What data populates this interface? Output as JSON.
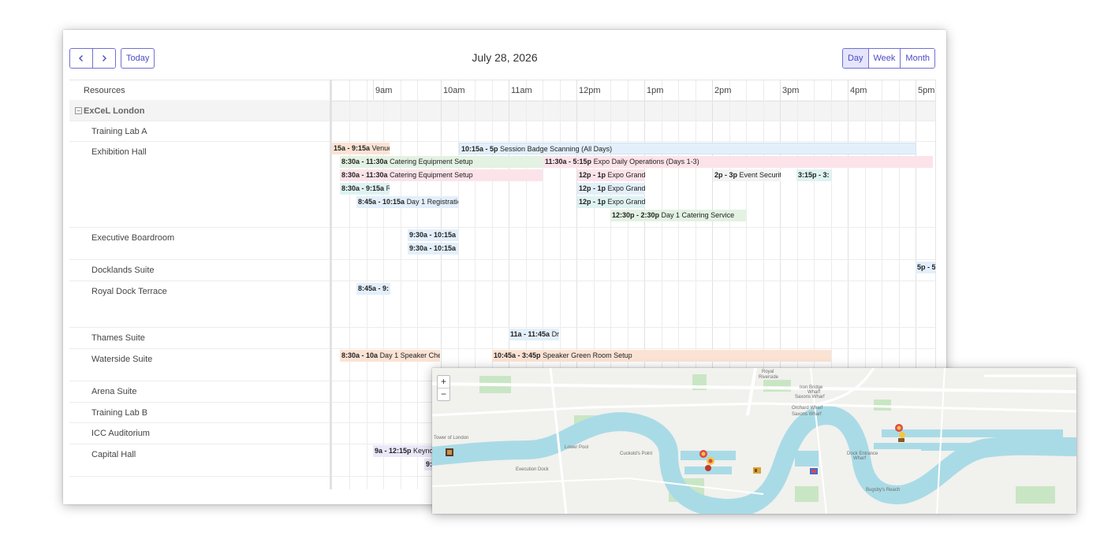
{
  "toolbar": {
    "prev_icon": "chevron-left-icon",
    "next_icon": "chevron-right-icon",
    "today_label": "Today",
    "title": "July 28, 2026",
    "views": [
      {
        "label": "Day",
        "active": true
      },
      {
        "label": "Week",
        "active": false
      },
      {
        "label": "Month",
        "active": false
      }
    ]
  },
  "resources": {
    "header": "Resources",
    "group": "ExCeL London",
    "items": [
      "Training Lab A",
      "Exhibition Hall",
      "Executive Boardroom",
      "Docklands Suite",
      "Royal Dock Terrace",
      "Thames Suite",
      "Waterside Suite",
      "Arena Suite",
      "Training Lab B",
      "ICC Auditorium",
      "Capital Hall"
    ]
  },
  "hours": [
    "9am",
    "10am",
    "11am",
    "12pm",
    "1pm",
    "2pm",
    "3pm",
    "4pm",
    "5pm"
  ],
  "events": [
    {
      "time": "15a - 9:15a",
      "title": "Venue",
      "color": "#fbe3d4"
    },
    {
      "time": "10:15a - 5p",
      "title": "Session Badge Scanning (All Days)",
      "color": "#e3effa"
    },
    {
      "time": "8:30a - 11:30a",
      "title": "Catering Equipment Setup",
      "color": "#e3f2e3"
    },
    {
      "time": "11:30a - 5:15p",
      "title": "Expo Daily Operations (Days 1-3)",
      "color": "#fce3ea"
    },
    {
      "time": "8:30a - 11:30a",
      "title": "Catering Equipment Setup",
      "color": "#fce3ea"
    },
    {
      "time": "12p - 1p",
      "title": "Expo Grand",
      "color": "#fce3ea"
    },
    {
      "time": "2p - 3p",
      "title": "Event Securit",
      "color": "#f3f3f3"
    },
    {
      "time": "3:15p - 3:",
      "title": "/",
      "color": "#def3f1"
    },
    {
      "time": "8:30a - 9:15a",
      "title": "R",
      "color": "#def3f1"
    },
    {
      "time": "12p - 1p",
      "title": "Expo Grand",
      "color": "#e3effa"
    },
    {
      "time": "8:45a - 10:15a",
      "title": "Day 1 Registratic",
      "color": "#e3effa"
    },
    {
      "time": "12p - 1p",
      "title": "Expo Grand",
      "color": "#def3f1"
    },
    {
      "time": "12:30p - 2:30p",
      "title": "Day 1 Catering Service",
      "color": "#e3f2e3"
    },
    {
      "time": "9:30a - 10:15a",
      "title": "S",
      "color": "#e3effa"
    },
    {
      "time": "9:30a - 10:15a",
      "title": "S",
      "color": "#e3effa"
    },
    {
      "time": "5p - 5",
      "title": "",
      "color": "#e3effa"
    },
    {
      "time": "8:45a - 9:",
      "title": "I",
      "color": "#e3effa"
    },
    {
      "time": "11a - 11:45a",
      "title": "Dr",
      "color": "#e3effa"
    },
    {
      "time": "8:30a - 10a",
      "title": "Day 1 Speaker Chec",
      "color": "#fbe3d4"
    },
    {
      "time": "10:45a - 3:45p",
      "title": "Speaker Green Room Setup",
      "color": "#fbe3d4"
    },
    {
      "time": "9a - 12:15p",
      "title": "Keyno",
      "color": "#ebe8fa"
    },
    {
      "time": "9:",
      "title": "",
      "color": "#ebe8fa"
    }
  ],
  "map": {
    "zoom_in": "+",
    "zoom_out": "−",
    "labels": [
      "Royal",
      "Riverside",
      "Iron Bridge",
      "Wharf",
      "Saxons Wharf",
      "Orchard Wharf",
      "Saxons Wharf",
      "Tower of London",
      "Lower Pool",
      "Cuckold's Point",
      "Dock Entrance",
      "Wharf",
      "Execution Dock",
      "Bugsby's Reach"
    ],
    "colors": {
      "water": "#a9dbe6",
      "park": "#c9e6c4",
      "land": "#f1f1ee"
    }
  }
}
